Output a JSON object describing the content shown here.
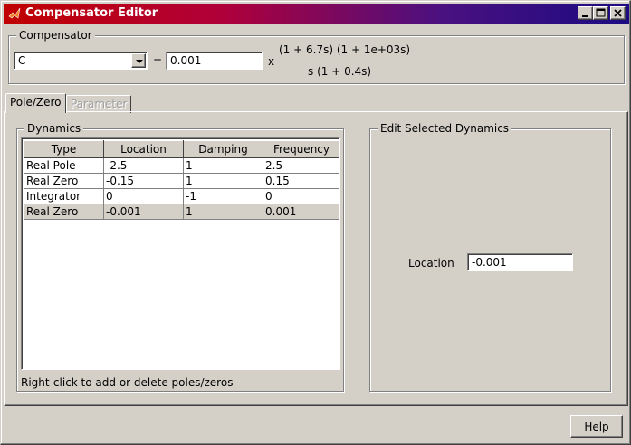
{
  "window": {
    "title": "Compensator Editor",
    "controls": {
      "minimize": "_",
      "maximize": "□",
      "close": "X"
    }
  },
  "compensator": {
    "group_label": "Compensator",
    "name_value": "C",
    "equals": "=",
    "gain_value": "0.001",
    "times": "x",
    "numerator": "(1 + 6.7s) (1 + 1e+03s)",
    "denominator": "s (1 + 0.4s)"
  },
  "tabs": [
    {
      "label": "Pole/Zero",
      "active": true,
      "enabled": true
    },
    {
      "label": "Parameter",
      "active": false,
      "enabled": false
    }
  ],
  "dynamics": {
    "group_label": "Dynamics",
    "columns": [
      "Type",
      "Location",
      "Damping",
      "Frequency"
    ],
    "rows": [
      [
        "Real Pole",
        "-2.5",
        "1",
        "2.5"
      ],
      [
        "Real Zero",
        "-0.15",
        "1",
        "0.15"
      ],
      [
        "Integrator",
        "0",
        "-1",
        "0"
      ],
      [
        "Real Zero",
        "-0.001",
        "1",
        "0.001"
      ]
    ],
    "selected_row": 3,
    "hint": "Right-click to add or delete poles/zeros"
  },
  "edit_selected": {
    "group_label": "Edit Selected Dynamics",
    "location_label": "Location",
    "location_value": "-0.001"
  },
  "footer": {
    "help_label": "Help"
  },
  "colors": {
    "background": "#d4d0c8",
    "title_start": "#c00000",
    "title_end": "#1c0b82"
  }
}
